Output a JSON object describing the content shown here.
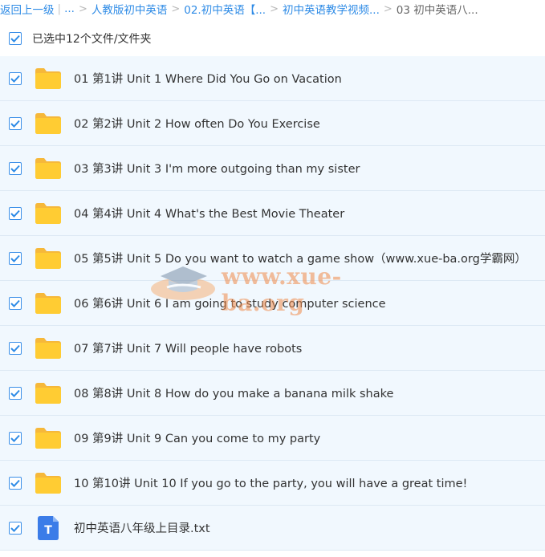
{
  "breadcrumb": {
    "back": "返回上一级",
    "ellipsis": "...",
    "crumbs": [
      "人教版初中英语",
      "02.初中英语【...",
      "初中英语教学视频...",
      "03 初中英语八..."
    ]
  },
  "selection": {
    "label": "已选中12个文件/文件夹"
  },
  "files": [
    {
      "name": "01 第1讲 Unit 1 Where Did You Go on Vacation",
      "type": "folder",
      "checked": true
    },
    {
      "name": "02 第2讲 Unit 2 How often Do You Exercise",
      "type": "folder",
      "checked": true
    },
    {
      "name": "03 第3讲 Unit 3 I'm more outgoing than my sister",
      "type": "folder",
      "checked": true
    },
    {
      "name": "04 第4讲 Unit 4 What's the Best Movie Theater",
      "type": "folder",
      "checked": true
    },
    {
      "name": "05 第5讲 Unit 5 Do you want to watch a game show（www.xue-ba.org学霸网）",
      "type": "folder",
      "checked": true
    },
    {
      "name": "06 第6讲 Unit 6 I am going to study computer science",
      "type": "folder",
      "checked": true
    },
    {
      "name": "07 第7讲 Unit 7 Will people have robots",
      "type": "folder",
      "checked": true
    },
    {
      "name": "08 第8讲 Unit 8 How do you make a banana milk shake",
      "type": "folder",
      "checked": true
    },
    {
      "name": "09 第9讲 Unit 9 Can you come to my party",
      "type": "folder",
      "checked": true
    },
    {
      "name": "10 第10讲 Unit 10 If you go to the party, you will have a great time!",
      "type": "folder",
      "checked": true
    },
    {
      "name": "初中英语八年级上目录.txt",
      "type": "txt",
      "checked": true,
      "icon_letter": "T"
    }
  ],
  "watermark": {
    "text": "www.xue-ba.org"
  },
  "colors": {
    "accent": "#2e8be6",
    "row_bg": "#f1f8fe",
    "folder": "#ffcc33",
    "txt_icon": "#3b7ce8"
  }
}
